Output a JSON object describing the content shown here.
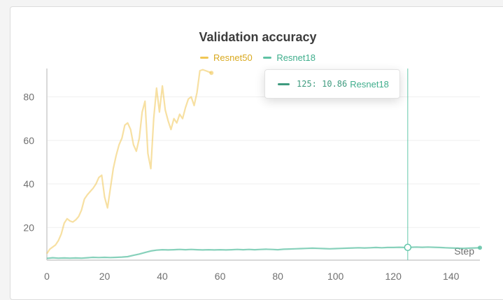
{
  "colors": {
    "resnet50": "#f0c755",
    "resnet18": "#5fc2a4",
    "resnet50_legend": "#d9a91f",
    "resnet18_legend": "#3fae8c",
    "tooltip_swatch": "#3f9b7f",
    "axis": "#d9d9d9",
    "grid": "#efefef",
    "tick_text": "#707070",
    "cursor": "#63c7aa"
  },
  "chart_data": {
    "type": "line",
    "title": "Validation accuracy",
    "xlabel": "Step",
    "ylabel": "",
    "xlim": [
      0,
      150
    ],
    "ylim": [
      5,
      93
    ],
    "x_ticks": [
      0,
      20,
      40,
      60,
      80,
      100,
      120,
      140
    ],
    "y_ticks": [
      20,
      40,
      60,
      80
    ],
    "grid": true,
    "legend_position": "top-center",
    "series": [
      {
        "name": "Resnet50",
        "color_key": "resnet50",
        "x": [
          0,
          1,
          2,
          3,
          4,
          5,
          6,
          7,
          8,
          9,
          10,
          11,
          12,
          13,
          14,
          15,
          16,
          17,
          18,
          19,
          20,
          21,
          22,
          23,
          24,
          25,
          26,
          27,
          28,
          29,
          30,
          31,
          32,
          33,
          34,
          35,
          36,
          37,
          38,
          39,
          40,
          41,
          42,
          43,
          44,
          45,
          46,
          47,
          48,
          49,
          50,
          51,
          52,
          53,
          54,
          55,
          56,
          57
        ],
        "values": [
          8,
          10,
          11,
          12,
          14,
          17,
          22,
          24,
          23,
          22.5,
          23.5,
          25,
          28,
          33,
          35,
          36.5,
          38,
          40,
          43,
          44,
          34,
          29,
          38,
          47,
          53,
          58,
          61,
          67,
          68,
          65,
          58,
          55,
          61,
          73,
          78,
          54,
          47,
          70,
          84,
          73,
          85,
          74,
          69,
          65,
          70,
          68,
          72,
          70,
          75,
          79,
          80,
          76,
          82,
          92,
          92.5,
          92,
          91.5,
          91
        ],
        "end_marker": true
      },
      {
        "name": "Resnet18",
        "color_key": "resnet18",
        "x": [
          0,
          2,
          4,
          6,
          8,
          10,
          12,
          14,
          16,
          18,
          20,
          22,
          24,
          26,
          28,
          30,
          32,
          34,
          36,
          38,
          40,
          42,
          44,
          46,
          48,
          50,
          52,
          54,
          56,
          58,
          60,
          62,
          64,
          66,
          68,
          70,
          72,
          74,
          76,
          78,
          80,
          82,
          84,
          86,
          88,
          90,
          92,
          94,
          96,
          98,
          100,
          102,
          104,
          106,
          108,
          110,
          112,
          114,
          116,
          118,
          120,
          122,
          124,
          125,
          126,
          128,
          130,
          132,
          134,
          136,
          138,
          140,
          142,
          144,
          146,
          148,
          150
        ],
        "values": [
          5.8,
          6.1,
          5.9,
          6.0,
          5.9,
          6.0,
          5.9,
          6.1,
          6.3,
          6.2,
          6.3,
          6.2,
          6.3,
          6.4,
          6.6,
          7.2,
          7.8,
          8.5,
          9.2,
          9.6,
          9.8,
          9.7,
          9.8,
          9.9,
          9.8,
          9.9,
          9.8,
          9.7,
          9.8,
          9.7,
          9.8,
          9.7,
          9.8,
          9.9,
          9.8,
          9.9,
          9.8,
          9.9,
          10.0,
          9.9,
          9.8,
          10.0,
          10.1,
          10.2,
          10.3,
          10.4,
          10.5,
          10.4,
          10.3,
          10.2,
          10.3,
          10.4,
          10.5,
          10.6,
          10.7,
          10.6,
          10.7,
          10.8,
          10.7,
          10.8,
          10.8,
          10.9,
          10.8,
          10.86,
          10.9,
          11.0,
          10.9,
          11.0,
          10.9,
          10.8,
          10.7,
          10.6,
          10.5,
          10.4,
          10.5,
          10.6,
          10.7
        ],
        "end_marker": true
      }
    ],
    "hover": {
      "x": 125,
      "value_text": "125: 10.86",
      "series_name": "Resnet18"
    }
  }
}
